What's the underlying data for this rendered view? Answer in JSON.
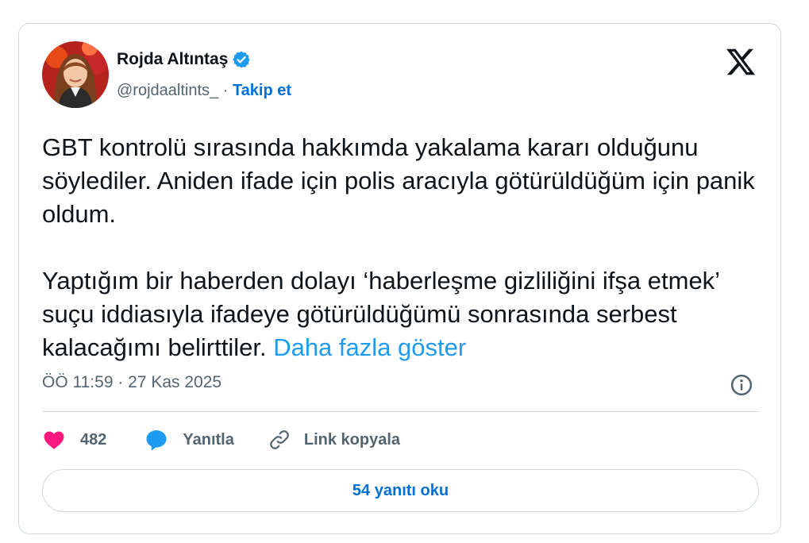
{
  "tweet": {
    "author_name": "Rojda Altıntaş",
    "handle": "@rojdaaltints_",
    "separator": "·",
    "follow_label": "Takip et",
    "text_paragraph_1": "GBT kontrolü sırasında hakkımda yakalama kararı olduğunu söylediler. Aniden ifade için polis aracıyla götürüldüğüm için panik oldum.",
    "text_paragraph_2": "Yaptığım bir haberden dolayı ‘haberleşme gizliliğini ifşa etmek’ suçu iddiasıyla ifadeye götürüldüğümü sonrasında serbest kalacağımı belirttiler.",
    "show_more_label": "Daha fazla göster",
    "timestamp": "ÖÖ 11:59 · 27 Kas 2025"
  },
  "actions": {
    "like_count": "482",
    "reply_label": "Yanıtla",
    "copy_link_label": "Link kopyala"
  },
  "read_replies_label": "54 yanıtı oku",
  "icons": {
    "verified": "verified-badge-icon",
    "brand": "x-logo-icon",
    "info": "info-icon",
    "like": "heart-icon",
    "reply": "speech-bubble-icon",
    "copy_link": "link-icon"
  },
  "colors": {
    "accent": "#1d9bf0",
    "link_blue": "#006fd6",
    "like_pink": "#f91880",
    "secondary_text": "#536471",
    "border": "#cfd9de"
  }
}
